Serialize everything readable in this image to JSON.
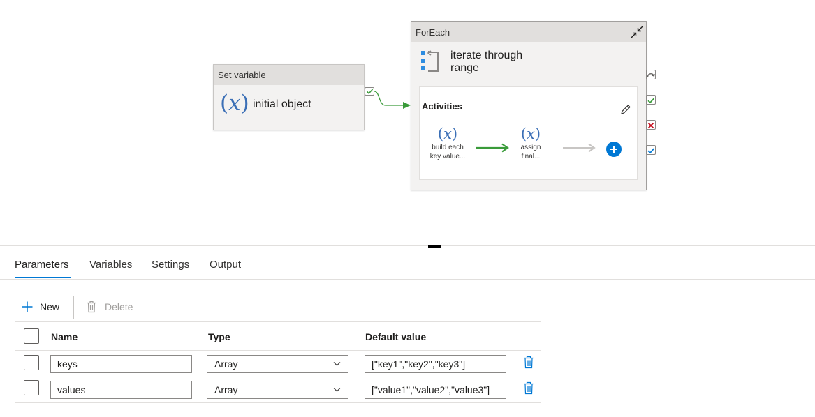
{
  "pipeline": {
    "setvariable": {
      "header": "Set variable",
      "icon": "variable-x-icon",
      "label": "initial object"
    },
    "foreach": {
      "header": "ForEach",
      "title_line1": "iterate through",
      "title_line2": "range",
      "activities_title": "Activities",
      "activity1": {
        "label_line1": "build each",
        "label_line2": "key value..."
      },
      "activity2": {
        "label_line1": "assign",
        "label_line2": "final..."
      }
    },
    "colors": {
      "success_green": "#3a9b3a",
      "failure_red": "#c50f1f",
      "accent_blue": "#0078d4",
      "variable_blue": "#3b6fb6"
    }
  },
  "tabs": [
    {
      "label": "Parameters",
      "active": true
    },
    {
      "label": "Variables"
    },
    {
      "label": "Settings"
    },
    {
      "label": "Output"
    }
  ],
  "toolbar": {
    "new_label": "New",
    "delete_label": "Delete"
  },
  "table": {
    "headers": {
      "name": "Name",
      "type": "Type",
      "default": "Default value"
    },
    "rows": [
      {
        "name": "keys",
        "type": "Array",
        "default": "[\"key1\",\"key2\",\"key3\"]"
      },
      {
        "name": "values",
        "type": "Array",
        "default": "[\"value1\",\"value2\",\"value3\"]"
      }
    ]
  }
}
